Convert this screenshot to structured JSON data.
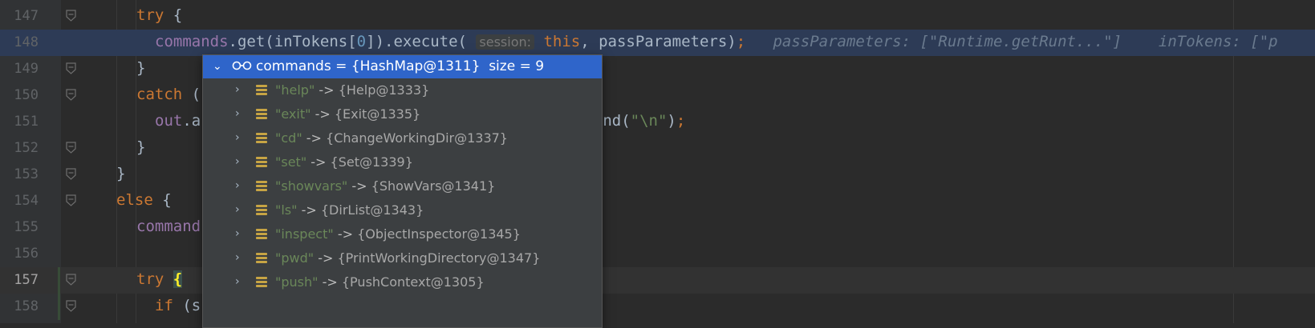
{
  "editor": {
    "lines": [
      {
        "num": "147",
        "segments": [
          {
            "t": "try",
            "c": "kw"
          },
          {
            "t": " {",
            "c": ""
          }
        ]
      },
      {
        "num": "148",
        "segments": [
          {
            "t": "commands",
            "c": "fld"
          },
          {
            "t": ".get(inTokens[",
            "c": ""
          },
          {
            "t": "0",
            "c": "num"
          },
          {
            "t": "]).execute( ",
            "c": ""
          },
          {
            "t": "session:",
            "c": "hint"
          },
          {
            "t": " this",
            "c": "kw"
          },
          {
            "t": ", passParameters)",
            "c": ""
          },
          {
            "t": ";",
            "c": "kw"
          },
          {
            "t": "   passParameters: [\"Runtime.getRunt...\"]    inTokens: [\"p",
            "c": "inlay"
          }
        ]
      },
      {
        "num": "149",
        "segments": [
          {
            "t": "}",
            "c": ""
          }
        ]
      },
      {
        "num": "150",
        "segments": [
          {
            "t": "catch",
            "c": "kw"
          },
          {
            "t": " (",
            "c": ""
          }
        ]
      },
      {
        "num": "151",
        "segments": [
          {
            "t": "out",
            "c": "fld"
          },
          {
            "t": ".a",
            "c": ""
          }
        ]
      },
      {
        "num": "152",
        "segments": [
          {
            "t": "}",
            "c": ""
          }
        ]
      },
      {
        "num": "153",
        "segments": [
          {
            "t": "}",
            "c": ""
          }
        ]
      },
      {
        "num": "154",
        "segments": [
          {
            "t": "else",
            "c": "kw"
          },
          {
            "t": " {",
            "c": ""
          }
        ]
      },
      {
        "num": "155",
        "segments": [
          {
            "t": "command",
            "c": "fld"
          }
        ]
      },
      {
        "num": "156",
        "segments": []
      },
      {
        "num": "157",
        "segments": [
          {
            "t": "try",
            "c": "kw"
          },
          {
            "t": " ",
            "c": ""
          },
          {
            "t": "{",
            "c": "brace"
          }
        ]
      },
      {
        "num": "158",
        "segments": [
          {
            "t": "if",
            "c": "kw"
          },
          {
            "t": " (s",
            "c": ""
          }
        ]
      }
    ],
    "line151_tail": [
      {
        "t": "ppend(",
        "c": ""
      },
      {
        "t": "\"\\n\"",
        "c": "str"
      },
      {
        "t": ")",
        "c": ""
      },
      {
        "t": ";",
        "c": "kw"
      }
    ]
  },
  "popup": {
    "header": {
      "name": "commands",
      "type": "{HashMap@1311}",
      "size": "size = 9"
    },
    "items": [
      {
        "key": "\"help\"",
        "value": "{Help@1333}"
      },
      {
        "key": "\"exit\"",
        "value": "{Exit@1335}"
      },
      {
        "key": "\"cd\"",
        "value": "{ChangeWorkingDir@1337}"
      },
      {
        "key": "\"set\"",
        "value": "{Set@1339}"
      },
      {
        "key": "\"showvars\"",
        "value": "{ShowVars@1341}"
      },
      {
        "key": "\"ls\"",
        "value": "{DirList@1343}"
      },
      {
        "key": "\"inspect\"",
        "value": "{ObjectInspector@1345}"
      },
      {
        "key": "\"pwd\"",
        "value": "{PrintWorkingDirectory@1347}"
      },
      {
        "key": "\"push\"",
        "value": "{PushContext@1305}"
      }
    ],
    "arrow": "->"
  }
}
